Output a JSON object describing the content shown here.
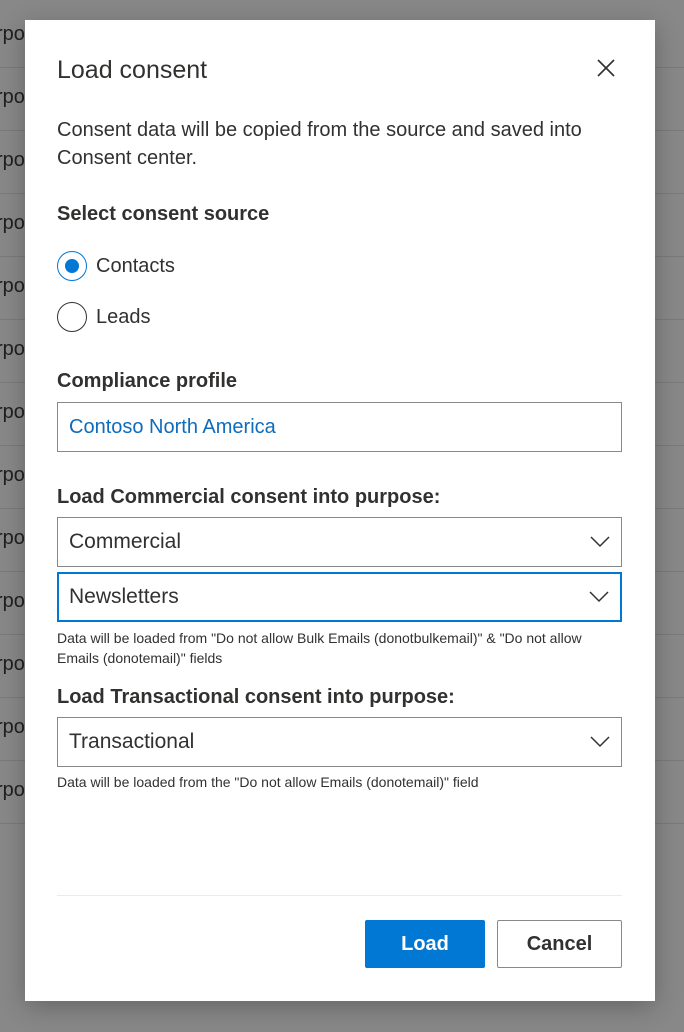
{
  "background": {
    "row_text": "rpo",
    "row_count": 13
  },
  "dialog": {
    "title": "Load consent",
    "description": "Consent data will be copied from the source and saved into Consent center.",
    "source": {
      "label": "Select consent source",
      "options": [
        {
          "label": "Contacts",
          "checked": true
        },
        {
          "label": "Leads",
          "checked": false
        }
      ]
    },
    "compliance": {
      "label": "Compliance profile",
      "value": "Contoso North America"
    },
    "commercial": {
      "label": "Load Commercial consent into purpose:",
      "dropdown1": "Commercial",
      "dropdown2": "Newsletters",
      "hint": "Data will be loaded from \"Do not allow Bulk Emails (donotbulkemail)\" & \"Do not allow Emails (donotemail)\" fields"
    },
    "transactional": {
      "label": "Load Transactional consent into purpose:",
      "dropdown": "Transactional",
      "hint": "Data will be loaded from the \"Do not allow Emails (donotemail)\" field"
    },
    "buttons": {
      "load": "Load",
      "cancel": "Cancel"
    },
    "colors": {
      "accent": "#0078d4",
      "link": "#0f6cbd",
      "overlay": "#888888"
    },
    "icons": {
      "close": "close-icon",
      "chevron": "chevron-down-icon"
    }
  }
}
